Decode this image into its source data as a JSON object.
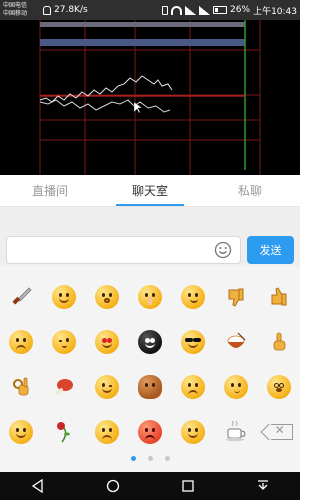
{
  "status_bar": {
    "carrier_line1": "中国电信",
    "carrier_line2": "中国移动",
    "net_speed": "27.8K/s",
    "battery_percent": "26%",
    "time": "上午10:43"
  },
  "tabs": [
    {
      "label": "直播间",
      "active": false
    },
    {
      "label": "聊天室",
      "active": true
    },
    {
      "label": "私聊",
      "active": false
    }
  ],
  "chat_input": {
    "value": "",
    "placeholder": ""
  },
  "send_button": {
    "label": "发送"
  },
  "emoji_grid": {
    "rows": [
      [
        "knife-icon",
        "grin-face-icon",
        "surprised-face-icon",
        "shh-face-icon",
        "smirk-face-icon",
        "thumbs-down-icon",
        "thumbs-up-icon"
      ],
      [
        "cry-face-icon",
        "wink-kiss-face-icon",
        "heart-eyes-face-icon",
        "black-monster-icon",
        "sunglasses-face-icon",
        "rice-bowl-icon",
        "point-up-hand-icon"
      ],
      [
        "ok-hand-icon",
        "drumstick-icon",
        "wink-face-icon",
        "poop-icon",
        "sweat-face-icon",
        "thinking-face-icon",
        "dizzy-face-icon"
      ],
      [
        "hug-face-icon",
        "wilted-rose-icon",
        "angry-face-icon",
        "red-face-icon",
        "smile-face-icon",
        "coffee-cup-icon",
        "delete-key-icon"
      ]
    ]
  },
  "pagination": {
    "pages": 3,
    "current": 1
  },
  "colors": {
    "accent": "#2d9bf0",
    "chart_bg": "#000000",
    "chart_grid": "#8b1a1a",
    "status_bar_bg": "#2f2f2f"
  }
}
